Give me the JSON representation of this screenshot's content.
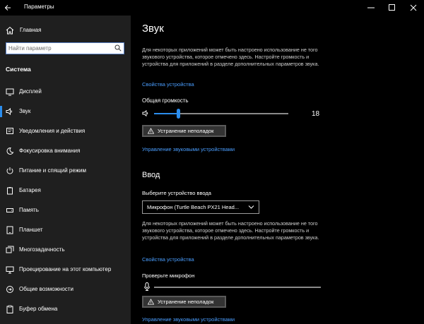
{
  "window": {
    "title": "Параметры"
  },
  "sidebar": {
    "home_label": "Главная",
    "search_placeholder": "Найти параметр",
    "section_label": "Система",
    "items": [
      {
        "label": "Дисплей",
        "icon": "display-icon"
      },
      {
        "label": "Звук",
        "icon": "speaker-icon",
        "active": true
      },
      {
        "label": "Уведомления и действия",
        "icon": "notification-icon"
      },
      {
        "label": "Фокусировка внимания",
        "icon": "moon-icon"
      },
      {
        "label": "Питание и спящий режим",
        "icon": "power-icon"
      },
      {
        "label": "Батарея",
        "icon": "battery-icon"
      },
      {
        "label": "Память",
        "icon": "storage-icon"
      },
      {
        "label": "Планшет",
        "icon": "tablet-icon"
      },
      {
        "label": "Многозадачность",
        "icon": "multitasking-icon"
      },
      {
        "label": "Проецирование на этот компьютер",
        "icon": "projecting-icon"
      },
      {
        "label": "Общие возможности",
        "icon": "shared-experiences-icon"
      },
      {
        "label": "Буфер обмена",
        "icon": "clipboard-icon"
      }
    ]
  },
  "main": {
    "title": "Звук",
    "output": {
      "description": "Для некоторых приложений может быть настроено использование не того звукового устройства, которое отмечено здесь. Настройте громкость и устройства для приложений в разделе дополнительных параметров звука.",
      "device_properties_link": "Свойства устройства",
      "master_volume_label": "Общая громкость",
      "volume_value": "18",
      "volume_percent": 18,
      "troubleshoot_button": "Устранение неполадок",
      "manage_devices_link": "Управление звуковыми устройствами"
    },
    "input": {
      "heading": "Ввод",
      "choose_device_label": "Выберите устройство ввода",
      "selected_device": "Микрофон (Turtle Beach PX21 Head...",
      "description": "Для некоторых приложений может быть настроено использование не того звукового устройства, которое отмечено здесь. Настройте громкость и устройства для приложений в разделе дополнительных параметров звука.",
      "device_properties_link": "Свойства устройства",
      "test_mic_label": "Проверьте микрофон",
      "troubleshoot_button": "Устранение неполадок",
      "manage_devices_link": "Управление звуковыми устройствами"
    }
  },
  "colors": {
    "accent": "#2b8ded",
    "link": "#4a9eff",
    "sidebar_bg": "#1f1f1f",
    "main_bg": "#000000"
  }
}
